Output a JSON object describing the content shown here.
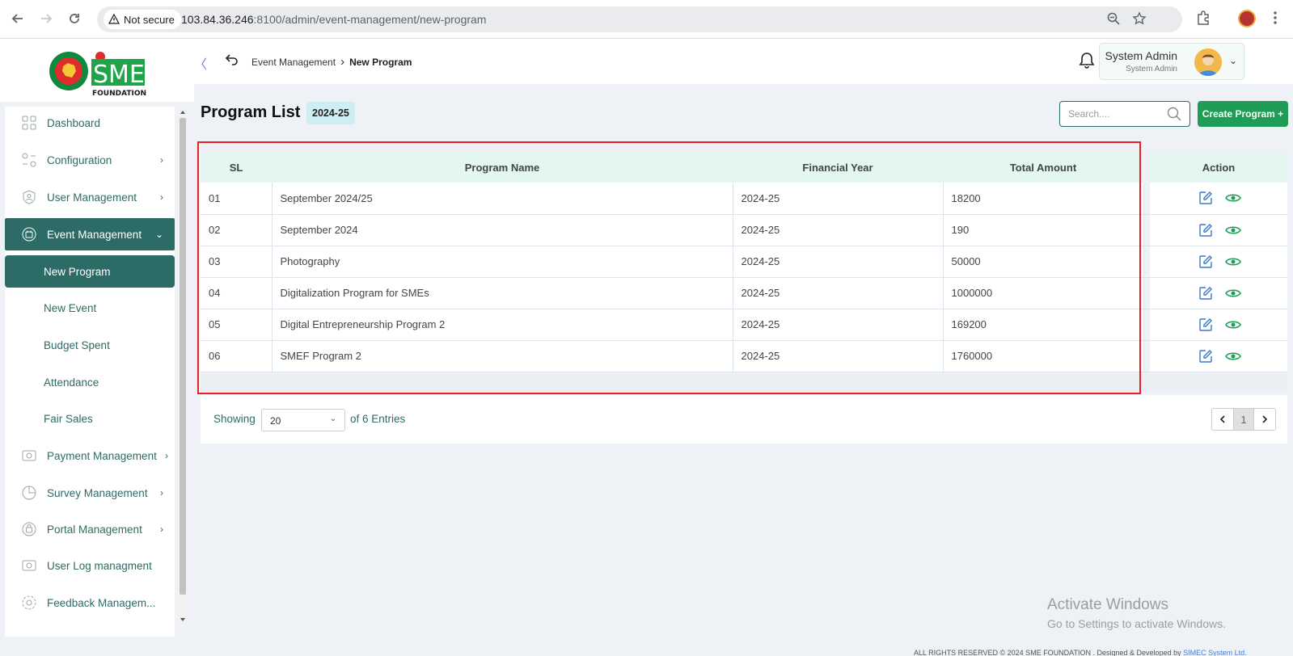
{
  "browser": {
    "security_label": "Not secure",
    "url_host": "103.84.36.246",
    "url_rest": ":8100/admin/event-management/new-program"
  },
  "logo": {
    "name": "SME",
    "sub": "FOUNDATION"
  },
  "sidebar": {
    "items": [
      {
        "label": "Dashboard"
      },
      {
        "label": "Configuration",
        "chevron": "›"
      },
      {
        "label": "User Management",
        "chevron": "›"
      },
      {
        "label": "Event Management",
        "chevron": "⌄"
      },
      {
        "label": "Payment Management",
        "chevron": "›"
      },
      {
        "label": "Survey Management",
        "chevron": "›"
      },
      {
        "label": "Portal Management",
        "chevron": "›"
      },
      {
        "label": "User Log managment"
      },
      {
        "label": "Feedback Managem..."
      }
    ],
    "sub_items": [
      {
        "label": "New Program"
      },
      {
        "label": "New Event"
      },
      {
        "label": "Budget Spent"
      },
      {
        "label": "Attendance"
      },
      {
        "label": "Fair Sales"
      }
    ]
  },
  "header": {
    "collapse": "〈",
    "breadcrumb_parent": "Event Management",
    "breadcrumb_sep": "›",
    "breadcrumb_current": "New Program",
    "user_name": "System Admin",
    "user_role": "System Admin"
  },
  "main": {
    "title": "Program List",
    "fiscal_year": "2024-25",
    "search_placeholder": "Search....",
    "create_label": "Create Program +"
  },
  "table": {
    "headers": [
      "SL",
      "Program Name",
      "Financial Year",
      "Total Amount",
      "Action"
    ],
    "rows": [
      [
        "01",
        "September 2024/25",
        "2024-25",
        "18200"
      ],
      [
        "02",
        "September 2024",
        "2024-25",
        "190"
      ],
      [
        "03",
        "Photography",
        "2024-25",
        "50000"
      ],
      [
        "04",
        "Digitalization Program for SMEs",
        "2024-25",
        "1000000"
      ],
      [
        "05",
        "Digital Entrepreneurship Program 2",
        "2024-25",
        "169200"
      ],
      [
        "06",
        "SMEF Program 2",
        "2024-25",
        "1760000"
      ]
    ]
  },
  "pagination": {
    "showing": "Showing",
    "page_size": "20",
    "of_entries": "of 6 Entries",
    "current_page": "1"
  },
  "windows": {
    "line1": "Activate Windows",
    "line2": "Go to Settings to activate Windows."
  },
  "footer": {
    "text": "ALL RIGHTS RESERVED © 2024 SME FOUNDATION . Designed & Developed by",
    "link": "SIMEC System Ltd."
  },
  "colors": {
    "primary": "#2d6c66",
    "create_button": "#1f9d57",
    "highlight": "#ee1c25"
  }
}
